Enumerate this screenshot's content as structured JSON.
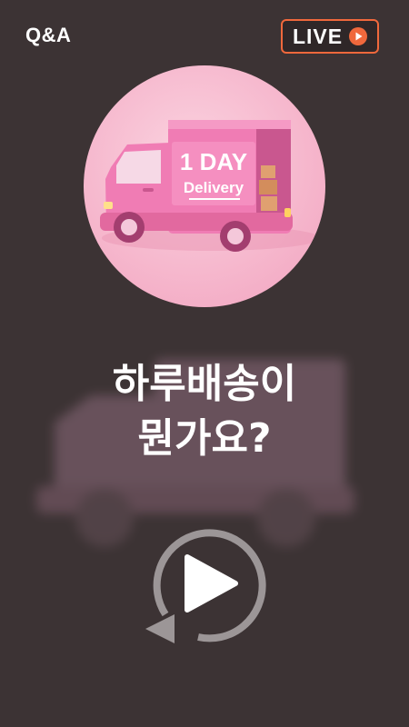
{
  "header": {
    "qa_label": "Q&A",
    "live_label": "LIVE",
    "live_icon": "play-circle-icon"
  },
  "hero": {
    "truck_text_line1": "1 DAY",
    "truck_text_line2": "Delivery"
  },
  "main": {
    "title_line1": "하루배송이",
    "title_line2": "뭔가요?"
  },
  "controls": {
    "replay_icon": "replay-icon"
  },
  "colors": {
    "background": "#3c3334",
    "accent": "#f0683c",
    "truck_pink": "#f07cb4",
    "circle_bg": "#f8c2d6"
  }
}
